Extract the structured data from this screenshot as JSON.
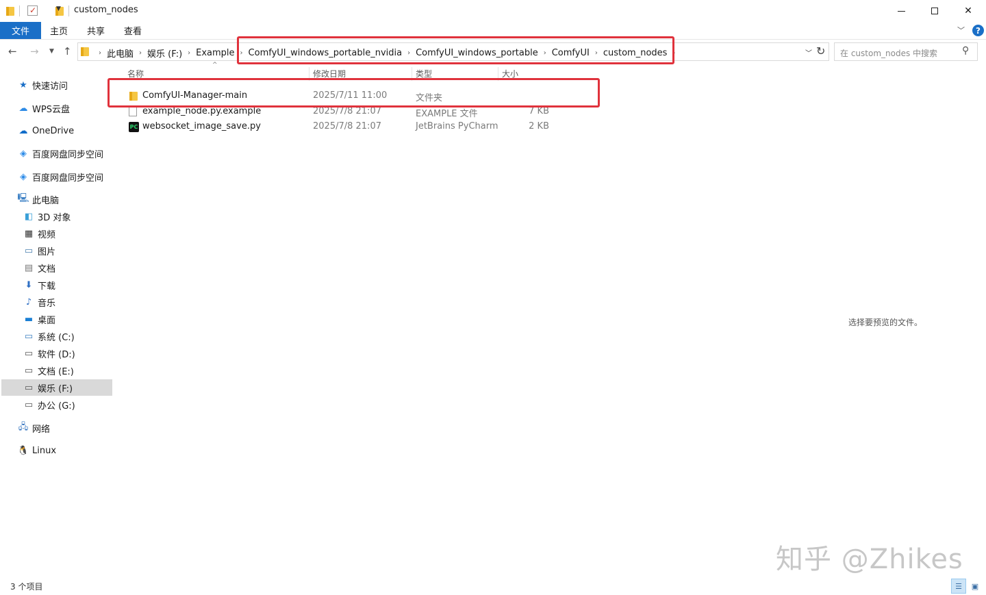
{
  "window": {
    "title": "custom_nodes",
    "controls": {
      "minimize": "minimize",
      "maximize": "maximize",
      "close": "✕"
    }
  },
  "ribbon": {
    "tabs": [
      "文件",
      "主页",
      "共享",
      "查看"
    ],
    "help": "?"
  },
  "address": {
    "crumbs": [
      "此电脑",
      "娱乐 (F:)",
      "Example",
      "ComfyUI_windows_portable_nvidia",
      "ComfyUI_windows_portable",
      "ComfyUI",
      "custom_nodes"
    ]
  },
  "search": {
    "placeholder": "在 custom_nodes 中搜索"
  },
  "sidebar": {
    "items": [
      {
        "label": "快速访问",
        "icon": "star-icon"
      },
      {
        "label": "WPS云盘",
        "icon": "cloud-icon"
      },
      {
        "label": "OneDrive",
        "icon": "onedrive-icon"
      },
      {
        "label": "百度网盘同步空间",
        "icon": "baidu-sync-icon"
      },
      {
        "label": "百度网盘同步空间",
        "icon": "baidu-sync-icon"
      },
      {
        "label": "此电脑",
        "icon": "computer-icon"
      },
      {
        "label": "3D 对象",
        "icon": "cube-icon"
      },
      {
        "label": "视频",
        "icon": "film-icon"
      },
      {
        "label": "图片",
        "icon": "picture-icon"
      },
      {
        "label": "文档",
        "icon": "document-icon"
      },
      {
        "label": "下载",
        "icon": "download-icon"
      },
      {
        "label": "音乐",
        "icon": "music-icon"
      },
      {
        "label": "桌面",
        "icon": "desktop-icon"
      },
      {
        "label": "系统 (C:)",
        "icon": "system-drive-icon"
      },
      {
        "label": "软件 (D:)",
        "icon": "drive-icon"
      },
      {
        "label": "文档 (E:)",
        "icon": "drive-icon"
      },
      {
        "label": "娱乐 (F:)",
        "icon": "drive-icon",
        "selected": true
      },
      {
        "label": "办公 (G:)",
        "icon": "drive-icon"
      },
      {
        "label": "网络",
        "icon": "network-icon"
      },
      {
        "label": "Linux",
        "icon": "linux-icon"
      }
    ]
  },
  "columns": {
    "name": "名称",
    "date": "修改日期",
    "type": "类型",
    "size": "大小"
  },
  "files": [
    {
      "name": "ComfyUI-Manager-main",
      "date": "2025/7/11 11:00",
      "type": "文件夹",
      "size": "",
      "icon": "folder-icon"
    },
    {
      "name": "example_node.py.example",
      "date": "2025/7/8 21:07",
      "type": "EXAMPLE 文件",
      "size": "7 KB",
      "icon": "file-icon"
    },
    {
      "name": "websocket_image_save.py",
      "date": "2025/7/8 21:07",
      "type": "JetBrains PyCharm",
      "size": "2 KB",
      "icon": "pycharm-icon"
    }
  ],
  "preview_message": "选择要预览的文件。",
  "status_text": "3 个项目",
  "watermark": "知乎 @Zhikes",
  "colors": {
    "accent": "#1a6fc7",
    "highlight": "#e0323c",
    "folder": "#f5c643"
  }
}
